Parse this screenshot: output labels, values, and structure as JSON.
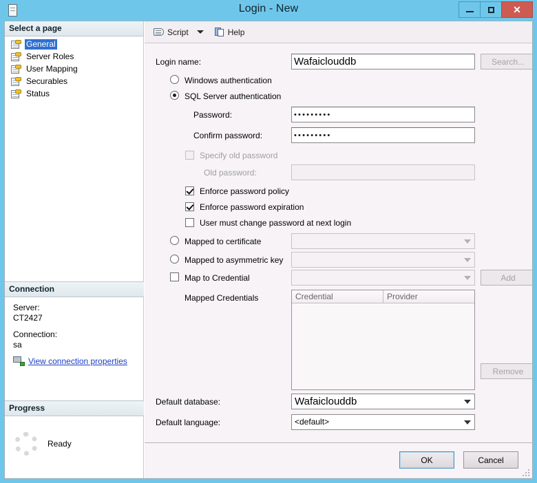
{
  "window": {
    "title": "Login - New",
    "icon": "server-icon",
    "controls": {
      "minimize": "minimize",
      "maximize": "maximize",
      "close": "close"
    },
    "accent_color": "#6ec7ea",
    "close_color": "#cd5b52"
  },
  "sidebar": {
    "pages_header": "Select a page",
    "items": [
      {
        "label": "General",
        "selected": true
      },
      {
        "label": "Server Roles",
        "selected": false
      },
      {
        "label": "User Mapping",
        "selected": false
      },
      {
        "label": "Securables",
        "selected": false
      },
      {
        "label": "Status",
        "selected": false
      }
    ],
    "connection_header": "Connection",
    "connection": {
      "server_label": "Server:",
      "server_value": "CT2427",
      "connection_label": "Connection:",
      "connection_value": "sa",
      "link": "View connection properties",
      "link_color": "#1a3fc4"
    },
    "progress_header": "Progress",
    "progress": {
      "status": "Ready"
    }
  },
  "toolbar": {
    "script_label": "Script",
    "help_label": "Help"
  },
  "form": {
    "login_name_label": "Login name:",
    "login_name_value": "Wafaiclouddb",
    "search_button": "Search...",
    "windows_auth_label": "Windows authentication",
    "sql_auth_label": "SQL Server authentication",
    "password_label": "Password:",
    "password_value": "•••••••••",
    "confirm_password_label": "Confirm password:",
    "confirm_password_value": "•••••••••",
    "specify_old_password_label": "Specify old password",
    "old_password_label": "Old password:",
    "old_password_value": "",
    "enforce_policy_label": "Enforce password policy",
    "enforce_expiration_label": "Enforce password expiration",
    "must_change_label": "User must change password at next login",
    "mapped_certificate_label": "Mapped to certificate",
    "mapped_certificate_value": "",
    "mapped_asymmetric_label": "Mapped to asymmetric key",
    "mapped_asymmetric_value": "",
    "map_credential_label": "Map to Credential",
    "map_credential_value": "",
    "add_button": "Add",
    "mapped_credentials_label": "Mapped Credentials",
    "grid_columns": [
      "Credential",
      "Provider"
    ],
    "grid_rows": [],
    "remove_button": "Remove",
    "default_database_label": "Default database:",
    "default_database_value": "Wafaiclouddb",
    "default_language_label": "Default language:",
    "default_language_value": "<default>"
  },
  "footer": {
    "ok_button": "OK",
    "cancel_button": "Cancel"
  }
}
